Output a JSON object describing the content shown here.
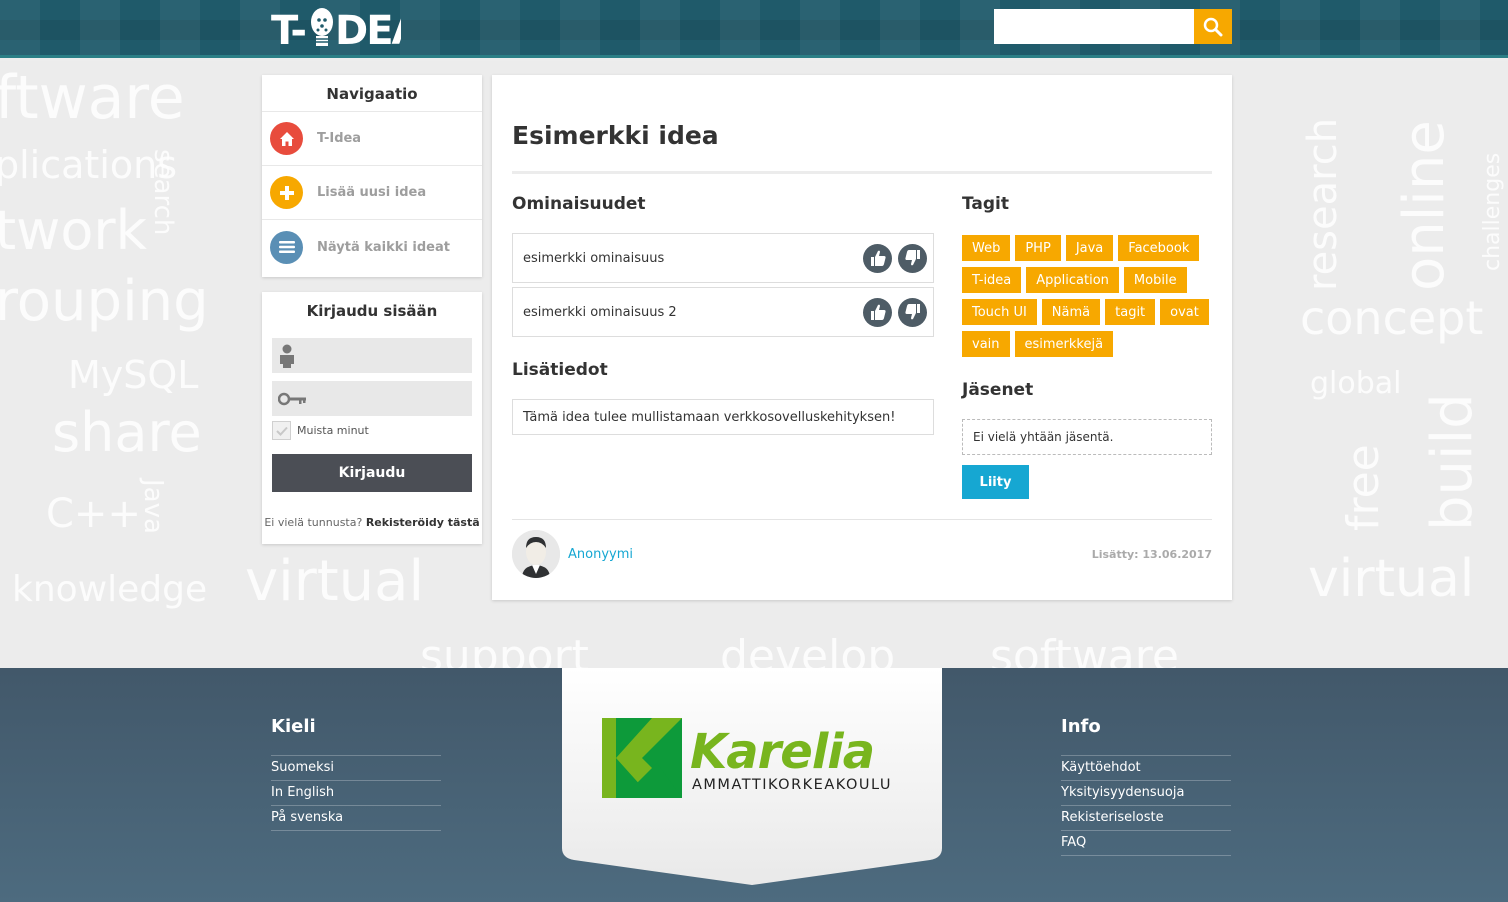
{
  "header": {
    "logo_text": "T-IDEA",
    "search": {
      "placeholder": "",
      "button_icon": "search-icon"
    },
    "colors": {
      "bar": "#1f5a6a",
      "accent": "#f7a800"
    }
  },
  "background_words": [
    "ftware",
    "plications",
    "search",
    "twork",
    "rouping",
    "MySQL",
    "share",
    "C++",
    "Java",
    "knowledge",
    "virtual",
    "support",
    "develop",
    "software",
    "research",
    "online",
    "concept",
    "global",
    "build",
    "free",
    "virtual",
    "challenges"
  ],
  "navigation": {
    "title": "Navigaatio",
    "items": [
      {
        "label": "T-Idea",
        "icon": "home-icon",
        "color": "#e84c3d"
      },
      {
        "label": "Lisää uusi idea",
        "icon": "plus-icon",
        "color": "#f7a800"
      },
      {
        "label": "Näytä kaikki ideat",
        "icon": "list-icon",
        "color": "#5a8fb5"
      }
    ]
  },
  "login": {
    "title": "Kirjaudu sisään",
    "username_icon": "user-icon",
    "password_icon": "key-icon",
    "remember_label": "Muista minut",
    "submit_label": "Kirjaudu",
    "register_prompt": "Ei vielä tunnusta?",
    "register_link": "Rekisteröidy tästä"
  },
  "idea": {
    "title": "Esimerkki idea",
    "features_title": "Ominaisuudet",
    "features": [
      {
        "text": "esimerkki ominaisuus"
      },
      {
        "text": "esimerkki ominaisuus 2"
      }
    ],
    "details_title": "Lisätiedot",
    "details_text": "Tämä idea tulee mullistamaan verkkosovelluskehityksen!",
    "tags_title": "Tagit",
    "tags": [
      "Web",
      "PHP",
      "Java",
      "Facebook",
      "T-idea",
      "Application",
      "Mobile",
      "Touch UI",
      "Nämä",
      "tagit",
      "ovat",
      "vain",
      "esimerkkejä"
    ],
    "members_title": "Jäsenet",
    "members_empty": "Ei vielä yhtään jäsentä.",
    "join_label": "Liity",
    "author": "Anonyymi",
    "added": "Lisätty: 13.06.2017"
  },
  "footer": {
    "left": {
      "title": "Kieli",
      "links": [
        "Suomeksi",
        "In English",
        "På svenska"
      ]
    },
    "logo": {
      "name": "Karelia",
      "subtitle": "AMMATTIKORKEAKOULU"
    },
    "right": {
      "title": "Info",
      "links": [
        "Käyttöehdot",
        "Yksityisyydensuoja",
        "Rekisteriseloste",
        "FAQ"
      ]
    }
  }
}
